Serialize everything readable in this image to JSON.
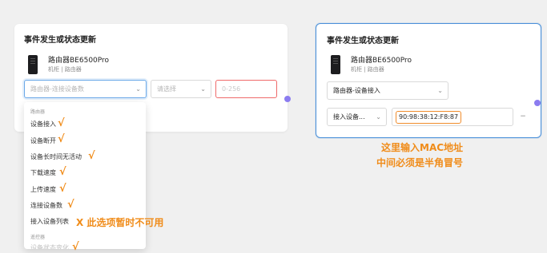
{
  "left_card": {
    "title": "事件发生或状态更新",
    "device_name": "路由器BE6500Pro",
    "device_sub": "机柜 | 路由器",
    "event_select": {
      "placeholder": "路由器-连接设备数"
    },
    "operator_select": {
      "placeholder": "请选择"
    },
    "value_input": {
      "placeholder": "0-256"
    }
  },
  "dropdown": {
    "group_label": "路由器",
    "items": [
      {
        "label": "设备接入"
      },
      {
        "label": "设备断开"
      },
      {
        "label": "设备长时间无活动"
      },
      {
        "label": "下载速度"
      },
      {
        "label": "上传速度"
      },
      {
        "label": "连接设备数"
      },
      {
        "label": "接入设备列表"
      }
    ],
    "group2_label": "遥控器"
  },
  "right_card": {
    "title": "事件发生或状态更新",
    "device_name": "路由器BE6500Pro",
    "device_sub": "机柜 | 路由器",
    "event_select": {
      "value": "路由器-设备接入"
    },
    "operator_select": {
      "value": "接入设备..."
    },
    "mac_value": "90:98:38:12:F8:87"
  },
  "annotations": {
    "check_mark": "√",
    "unavailable": "X 此选项暂时不可用",
    "mac_hint_line1": "这里输入MAC地址",
    "mac_hint_line2": "中间必须是半角冒号"
  },
  "colors": {
    "annotation": "#f08c1a",
    "focus_border": "#4a90d9",
    "error_border": "#ef6a6a",
    "handle_dot": "#8b7cf0"
  }
}
